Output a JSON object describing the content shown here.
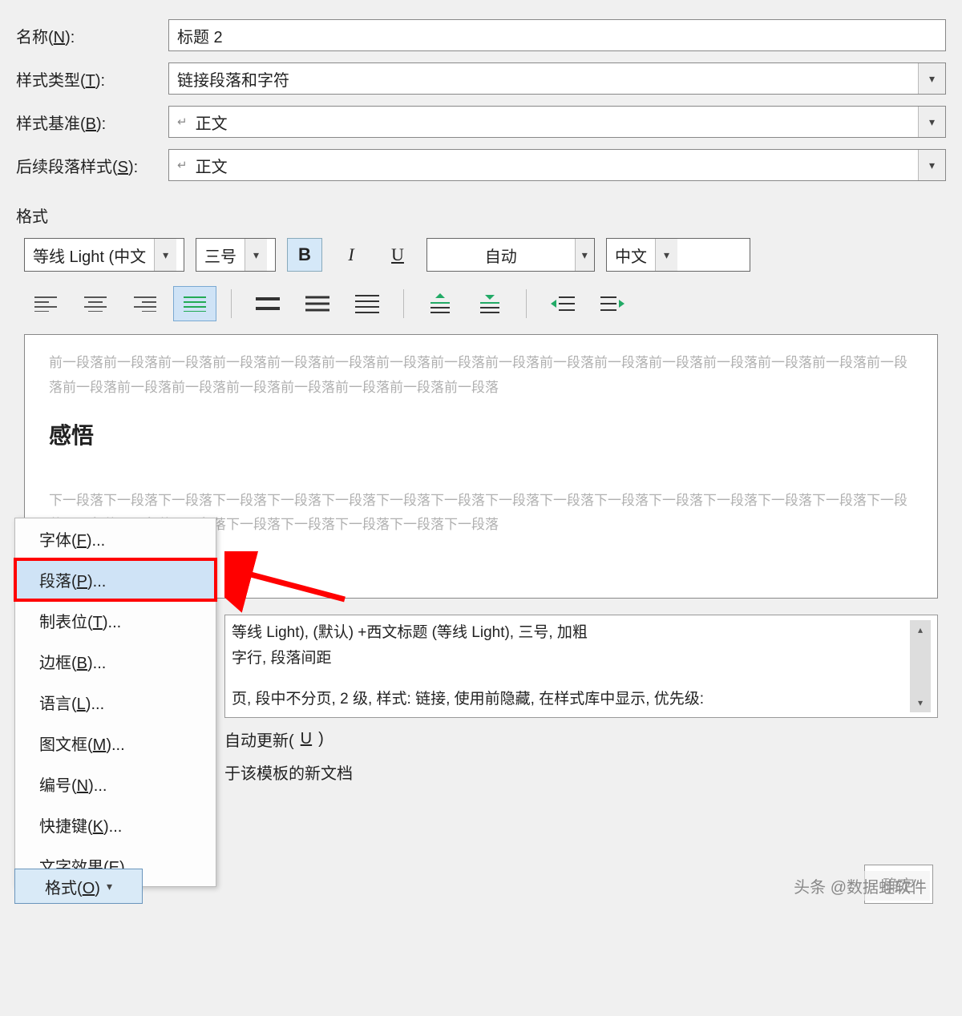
{
  "fields": {
    "name_label_pre": "名称(",
    "name_label_u": "N",
    "name_label_post": "):",
    "name_value": "标题 2",
    "styleType_label_pre": "样式类型(",
    "styleType_label_u": "T",
    "styleType_label_post": "):",
    "styleType_value": "链接段落和字符",
    "basedOn_label_pre": "样式基准(",
    "basedOn_label_u": "B",
    "basedOn_label_post": "):",
    "basedOn_value": "正文",
    "following_label_pre": "后续段落样式(",
    "following_label_u": "S",
    "following_label_post": "):",
    "following_value": "正文"
  },
  "section_format": "格式",
  "toolbar": {
    "font": "等线 Light (中文",
    "size": "三号",
    "bold": "B",
    "italic": "I",
    "underline": "U",
    "color": "自动",
    "lang": "中文"
  },
  "preview": {
    "prev_para": "前一段落前一段落前一段落前一段落前一段落前一段落前一段落前一段落前一段落前一段落前一段落前一段落前一段落前一段落前一段落前一段落前一段落前一段落前一段落前一段落前一段落前一段落前一段落前一段落",
    "title": "感悟",
    "next_para": "下一段落下一段落下一段落下一段落下一段落下一段落下一段落下一段落下一段落下一段落下一段落下一段落下一段落下一段落下一段落下一段落下一段落下一段落下一段落下一段落下一段落下一段落下一段落下一段落"
  },
  "description": {
    "line1": "等线 Light), (默认) +西文标题 (等线 Light), 三号, 加粗",
    "line2": "字行, 段落间距",
    "line3": "页, 段中不分页, 2 级, 样式: 链接, 使用前隐藏, 在样式库中显示, 优先级:"
  },
  "checkbox": {
    "auto_update_pre": "自动更新(",
    "auto_update_u": "U",
    "auto_update_post": ")",
    "template_doc": "于该模板的新文档"
  },
  "menu": {
    "font_pre": "字体(",
    "font_u": "F",
    "font_post": ")...",
    "para_pre": "段落(",
    "para_u": "P",
    "para_post": ")...",
    "tabs_pre": "制表位(",
    "tabs_u": "T",
    "tabs_post": ")...",
    "border_pre": "边框(",
    "border_u": "B",
    "border_post": ")...",
    "lang_pre": "语言(",
    "lang_u": "L",
    "lang_post": ")...",
    "frame_pre": "图文框(",
    "frame_u": "M",
    "frame_post": ")...",
    "num_pre": "编号(",
    "num_u": "N",
    "num_post": ")...",
    "shortcut_pre": "快捷键(",
    "shortcut_u": "K",
    "shortcut_post": ")...",
    "texteff_pre": "文字效果(",
    "texteff_u": "E",
    "texteff_post": ")..."
  },
  "format_button_pre": "格式(",
  "format_button_u": "O",
  "format_button_post": ")",
  "ok_button": "确定",
  "watermark": "头条 @数据蛙软件"
}
